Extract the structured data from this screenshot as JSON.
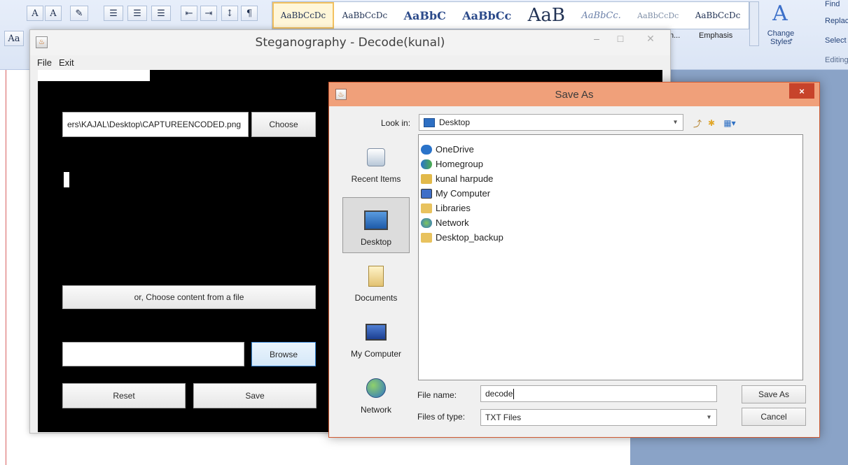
{
  "word": {
    "styles": [
      "AaBbCcDc",
      "AaBbCcDc",
      "AaBbC",
      "AaBbCc",
      "AaB",
      "AaBbCc.",
      "AaBbCcDc",
      "AaBbCcDc"
    ],
    "style_names": [
      "n...",
      "Emphasis"
    ],
    "change_styles_label": "Change Styles",
    "change_styles_sub": "*",
    "find_label": "Find",
    "replace_label": "Replace",
    "select_label": "Select",
    "editing_label": "Editing"
  },
  "steg": {
    "title": "Steganography - Decode(kunal)",
    "menu": [
      "File",
      "Exit"
    ],
    "path_value": "ers\\KAJAL\\Desktop\\CAPTUREENCODED.png",
    "choose_label": "Choose",
    "choose_file_label": "or, Choose content from a file",
    "browse_label": "Browse",
    "reset_label": "Reset",
    "save_label": "Save"
  },
  "saveas": {
    "title": "Save As",
    "close_glyph": "×",
    "look_in_label": "Look in:",
    "look_in_value": "Desktop",
    "places": [
      "Recent Items",
      "Desktop",
      "Documents",
      "My Computer",
      "Network"
    ],
    "files": [
      "OneDrive",
      "Homegroup",
      "kunal harpude",
      "My Computer",
      "Libraries",
      "Network",
      "Desktop_backup"
    ],
    "file_name_label": "File name:",
    "file_name_value": "decode",
    "files_of_type_label": "Files of type:",
    "files_of_type_value": "TXT Files",
    "save_button": "Save As",
    "cancel_button": "Cancel"
  },
  "colors": {
    "dialog_titlebar": "#f0a07a",
    "close_button": "#c7432b",
    "canvas": "#000000",
    "selection_blue": "#2d6fc3"
  }
}
